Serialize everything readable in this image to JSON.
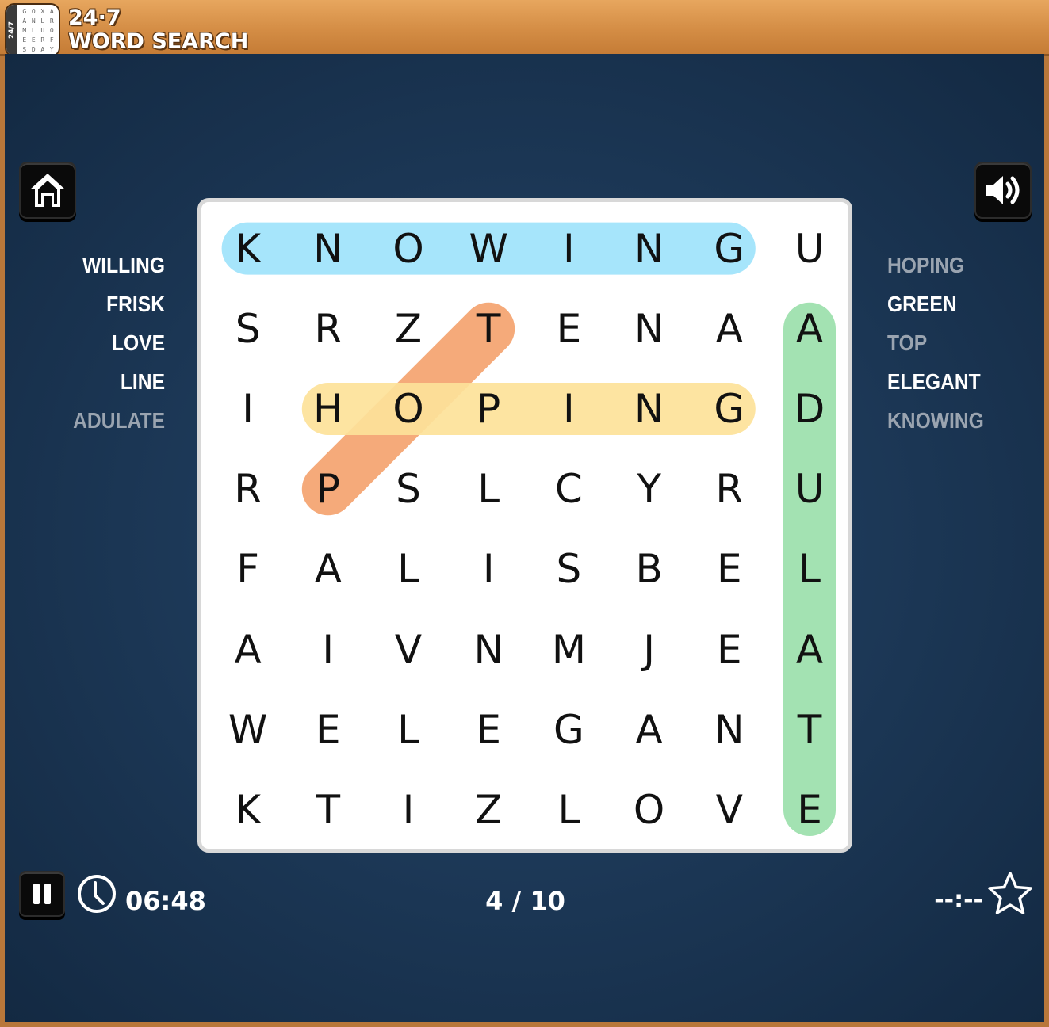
{
  "app": {
    "logo_line1": "24·7",
    "logo_line2": "WORD SEARCH",
    "logo_side": "24/7",
    "logo_letters": [
      "G",
      "O",
      "X",
      "A",
      "A",
      "N",
      "L",
      "R",
      "M",
      "L",
      "U",
      "O",
      "E",
      "E",
      "R",
      "F",
      "S",
      "D",
      "A",
      "Y"
    ]
  },
  "colors": {
    "wood": "#d48d45",
    "board_bg": "#1b3654",
    "highlight_blue": "#9fe3fb",
    "highlight_orange": "#f5a36f",
    "highlight_yellow": "#fde29a",
    "highlight_green": "#9ce0ac",
    "found_word": "#9aa4b0"
  },
  "buttons": {
    "home_icon": "home-icon",
    "sound_icon": "speaker-icon",
    "pause_icon": "pause-icon",
    "star_icon": "star-outline-icon"
  },
  "grid": [
    [
      "K",
      "N",
      "O",
      "W",
      "I",
      "N",
      "G",
      "U"
    ],
    [
      "S",
      "R",
      "Z",
      "T",
      "E",
      "N",
      "A",
      "A"
    ],
    [
      "I",
      "H",
      "O",
      "P",
      "I",
      "N",
      "G",
      "D"
    ],
    [
      "R",
      "P",
      "S",
      "L",
      "C",
      "Y",
      "R",
      "U"
    ],
    [
      "F",
      "A",
      "L",
      "I",
      "S",
      "B",
      "E",
      "L"
    ],
    [
      "A",
      "I",
      "V",
      "N",
      "M",
      "J",
      "E",
      "A"
    ],
    [
      "W",
      "E",
      "L",
      "E",
      "G",
      "A",
      "N",
      "T"
    ],
    [
      "K",
      "T",
      "I",
      "Z",
      "L",
      "O",
      "V",
      "E"
    ]
  ],
  "highlights": [
    {
      "word": "KNOWING",
      "from": [
        0,
        0
      ],
      "to": [
        0,
        6
      ],
      "color": "#9fe3fb"
    },
    {
      "word": "TOP",
      "from": [
        1,
        3
      ],
      "to": [
        3,
        1
      ],
      "color": "#f5a36f"
    },
    {
      "word": "HOPING",
      "from": [
        2,
        1
      ],
      "to": [
        2,
        6
      ],
      "color": "#fde29a"
    },
    {
      "word": "ADULATE",
      "from": [
        1,
        7
      ],
      "to": [
        7,
        7
      ],
      "color": "#9ce0ac"
    }
  ],
  "words_left": [
    {
      "text": "WILLING",
      "found": false
    },
    {
      "text": "FRISK",
      "found": false
    },
    {
      "text": "LOVE",
      "found": false
    },
    {
      "text": "LINE",
      "found": false
    },
    {
      "text": "ADULATE",
      "found": true
    }
  ],
  "words_right": [
    {
      "text": "HOPING",
      "found": true
    },
    {
      "text": "GREEN",
      "found": false
    },
    {
      "text": "TOP",
      "found": true
    },
    {
      "text": "ELEGANT",
      "found": false
    },
    {
      "text": "KNOWING",
      "found": true
    }
  ],
  "status": {
    "timer": "06:48",
    "progress": "4 / 10",
    "best_time": "--:--"
  }
}
